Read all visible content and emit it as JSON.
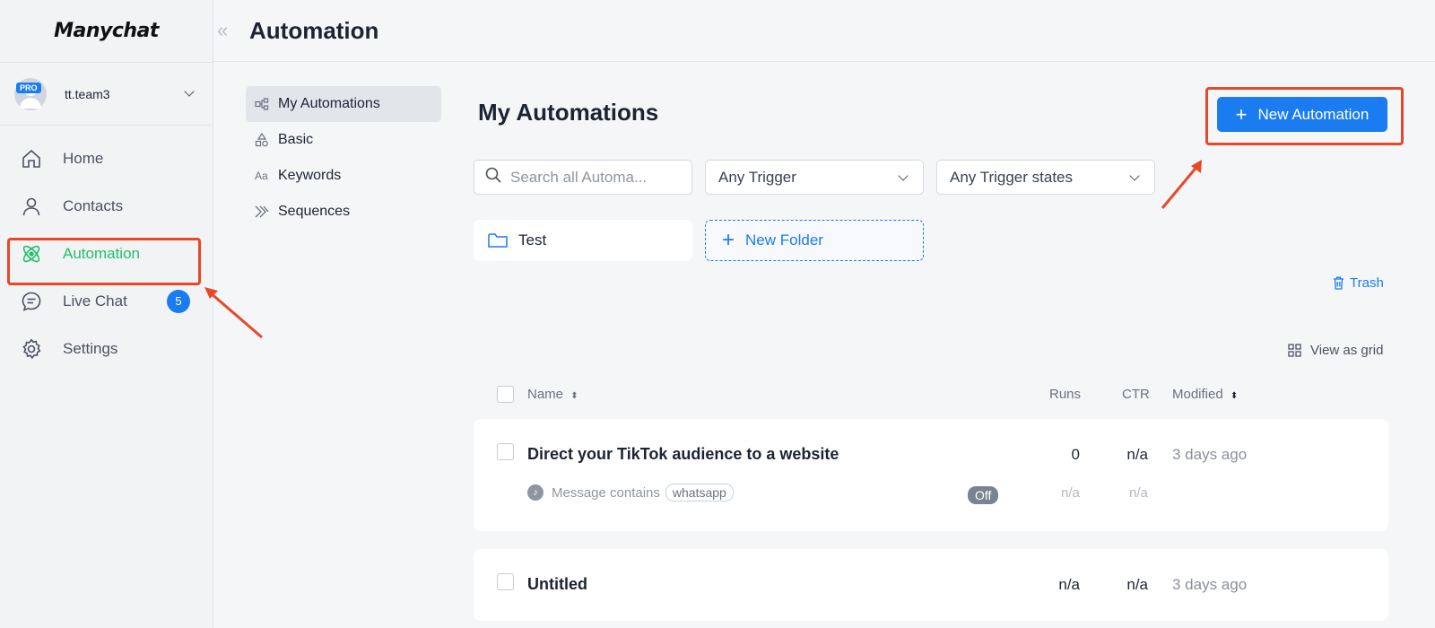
{
  "app": {
    "logo": "Manychat"
  },
  "account": {
    "name": "tt.team3",
    "badge": "PRO"
  },
  "nav": {
    "items": [
      {
        "label": "Home",
        "icon": "home-icon"
      },
      {
        "label": "Contacts",
        "icon": "person-icon"
      },
      {
        "label": "Automation",
        "icon": "automation-icon",
        "active": true
      },
      {
        "label": "Live Chat",
        "icon": "chat-icon",
        "badge": "5"
      },
      {
        "label": "Settings",
        "icon": "gear-icon"
      }
    ]
  },
  "header": {
    "title": "Automation",
    "collapse_glyph": "«"
  },
  "subnav": {
    "items": [
      {
        "label": "My Automations",
        "icon": "flow-icon",
        "active": true
      },
      {
        "label": "Basic",
        "icon": "shapes-icon"
      },
      {
        "label": "Keywords",
        "icon": "text-icon",
        "glyph": "Aa"
      },
      {
        "label": "Sequences",
        "icon": "sequence-icon"
      }
    ]
  },
  "main": {
    "title": "My Automations",
    "new_button": "New Automation",
    "search": {
      "placeholder": "Search all Automa..."
    },
    "filter_trigger": "Any Trigger",
    "filter_states": "Any Trigger states",
    "folder": "Test",
    "new_folder": "New Folder",
    "trash": "Trash",
    "view_grid": "View as grid"
  },
  "table": {
    "columns": {
      "name": "Name",
      "runs": "Runs",
      "ctr": "CTR",
      "modified": "Modified"
    },
    "rows": [
      {
        "name": "Direct your TikTok audience to a website",
        "runs": "0",
        "ctr": "n/a",
        "modified": "3 days ago",
        "trigger_text": "Message contains",
        "keyword": "whatsapp",
        "status": "Off",
        "sub_runs": "n/a",
        "sub_ctr": "n/a"
      },
      {
        "name": "Untitled",
        "runs": "n/a",
        "ctr": "n/a",
        "modified": "3 days ago"
      }
    ]
  },
  "colors": {
    "accent": "#1a7cf0",
    "active_nav": "#1fbf6a",
    "annotation": "#e8472a"
  }
}
